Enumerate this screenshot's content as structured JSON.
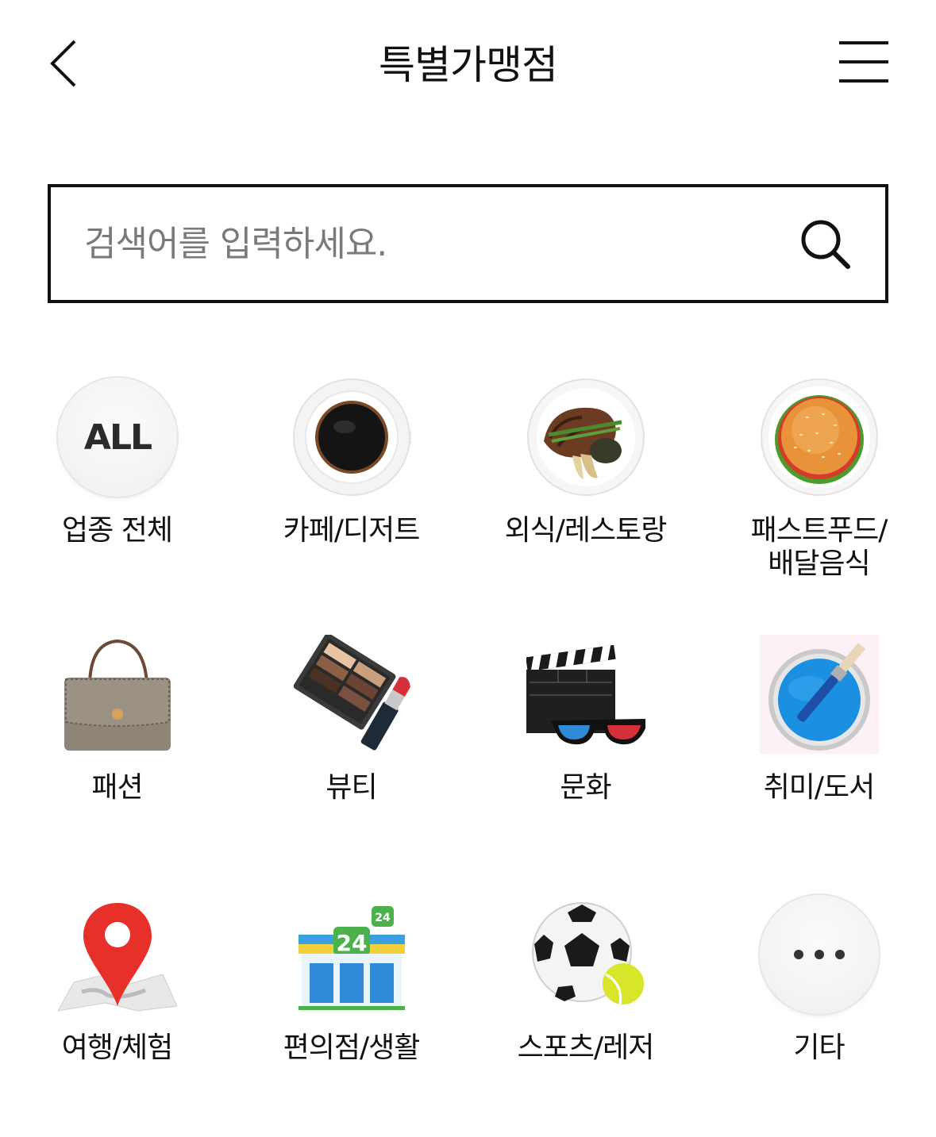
{
  "header": {
    "title": "특별가맹점",
    "back_icon": "chevron-left-icon",
    "menu_icon": "hamburger-menu-icon"
  },
  "search": {
    "placeholder": "검색어를 입력하세요.",
    "value": "",
    "icon": "search-icon"
  },
  "categories": [
    {
      "label": "업종 전체",
      "icon": "all-icon",
      "icon_text": "ALL"
    },
    {
      "label": "카페/디저트",
      "icon": "coffee-cup-icon"
    },
    {
      "label": "외식/레스토랑",
      "icon": "steak-plate-icon"
    },
    {
      "label": "패스트푸드/\n배달음식",
      "icon": "burger-icon"
    },
    {
      "label": "패션",
      "icon": "handbag-icon"
    },
    {
      "label": "뷰티",
      "icon": "makeup-icon"
    },
    {
      "label": "문화",
      "icon": "clapperboard-icon"
    },
    {
      "label": "취미/도서",
      "icon": "paint-bucket-icon"
    },
    {
      "label": "여행/체험",
      "icon": "map-pin-icon"
    },
    {
      "label": "편의점/생활",
      "icon": "convenience-store-icon",
      "icon_text": "24"
    },
    {
      "label": "스포츠/레저",
      "icon": "soccer-ball-icon"
    },
    {
      "label": "기타",
      "icon": "more-dots-icon"
    }
  ]
}
